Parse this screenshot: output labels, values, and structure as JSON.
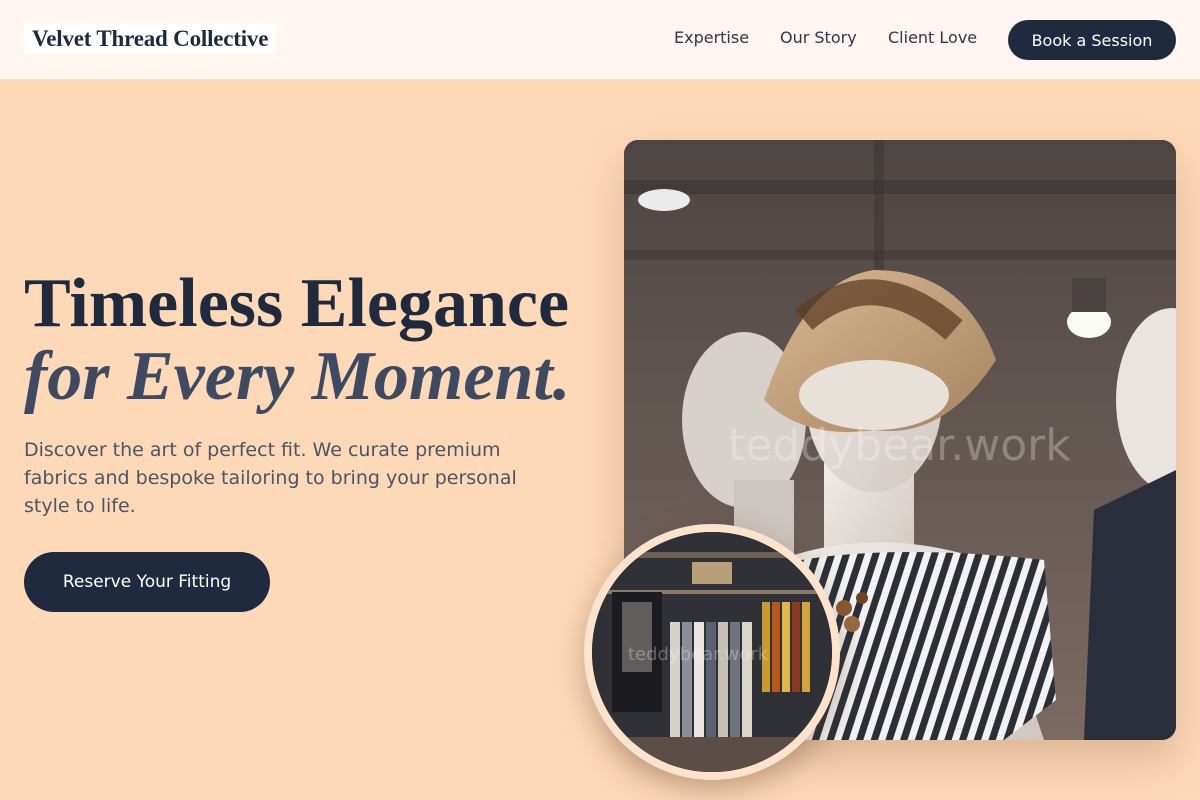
{
  "nav": {
    "brand": "Velvet Thread Collective",
    "links": [
      "Expertise",
      "Our Story",
      "Client Love"
    ],
    "cta": "Book a Session"
  },
  "hero": {
    "headline_line1": "Timeless Elegance",
    "headline_line2": "for Every Moment.",
    "description": "Discover the art of perfect fit. We curate premium fabrics and bespoke tailoring to bring your personal style to life.",
    "cta": "Reserve Your Fitting",
    "main_image_watermark": "teddybear.work",
    "inset_image_watermark": "teddybear.work"
  },
  "colors": {
    "background": "#fed9b7",
    "nav_background": "#fff6f1",
    "primary": "#1f2a3f",
    "text_muted": "#4a5568"
  }
}
